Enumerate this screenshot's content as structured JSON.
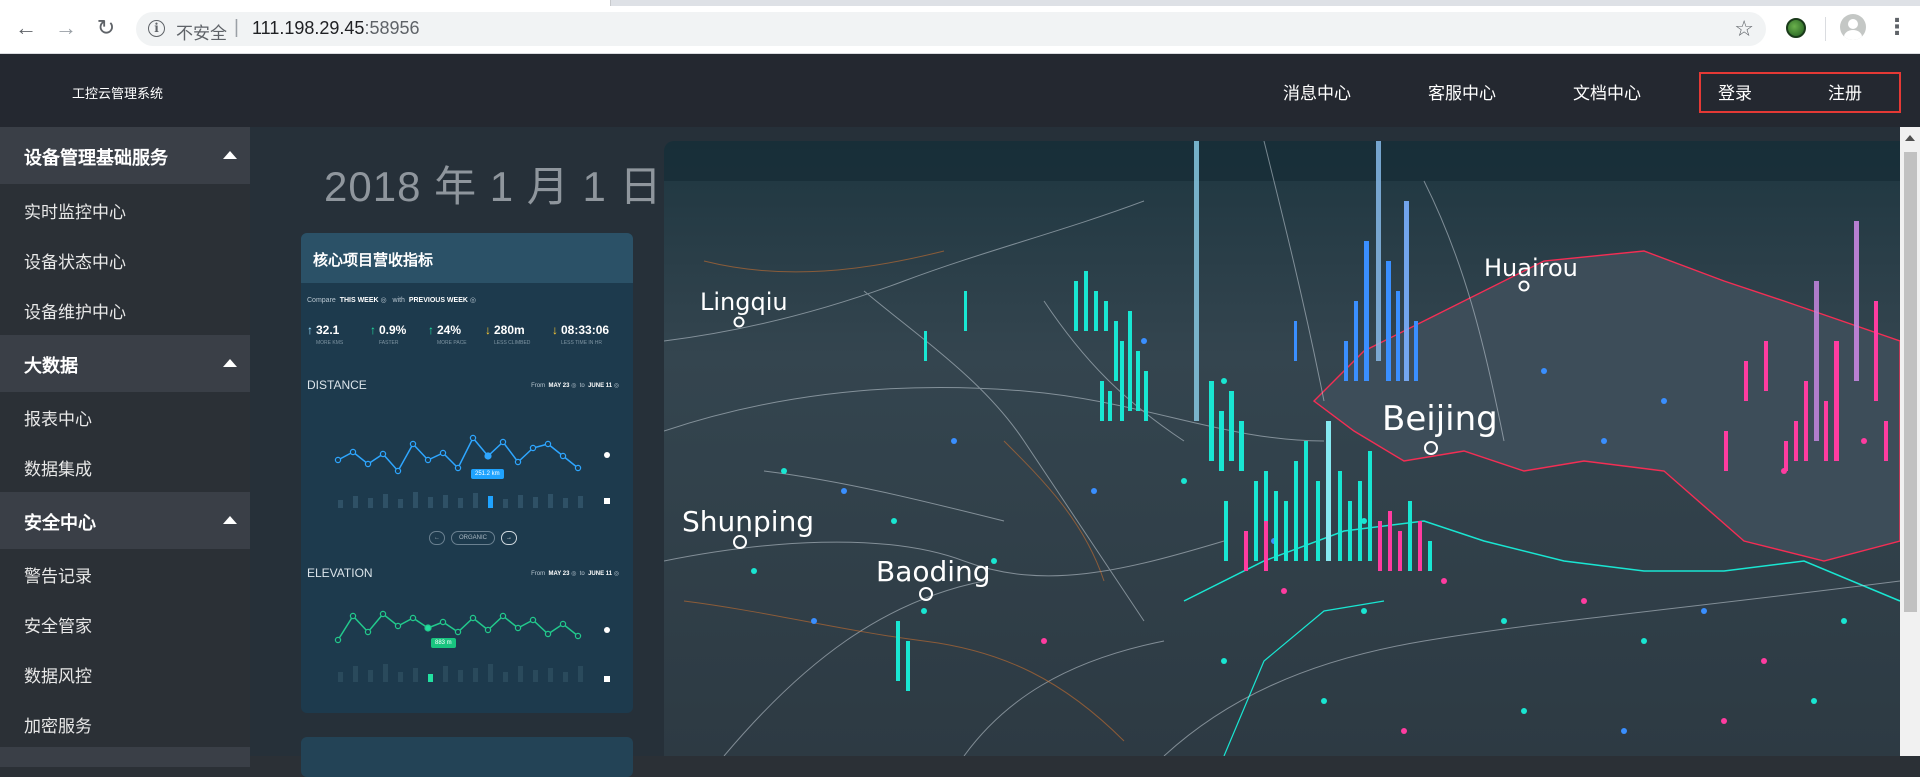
{
  "browser": {
    "insecure_label": "不安全",
    "separator": "|",
    "host": "111.198.29.45",
    "port": ":58956"
  },
  "header": {
    "brand": "工控云管理系统",
    "nav": [
      "消息中心",
      "客服中心",
      "文档中心"
    ],
    "login": "登录",
    "register": "注册"
  },
  "sidebar": {
    "sections": [
      {
        "title": "设备管理基础服务",
        "items": [
          "实时监控中心",
          "设备状态中心",
          "设备维护中心"
        ]
      },
      {
        "title": "大数据",
        "items": [
          "报表中心",
          "数据集成"
        ]
      },
      {
        "title": "安全中心",
        "items": [
          "警告记录",
          "安全管家",
          "数据风控",
          "加密服务"
        ]
      }
    ]
  },
  "main": {
    "date": "2018 年 1 月 1 日",
    "card_title": "核心项目营收指标",
    "compare": {
      "label": "Compare",
      "this_week": "THIS WEEK",
      "with": "with",
      "prev_week": "PREVIOUS WEEK"
    },
    "stats": [
      {
        "value": "32.1",
        "label": "MORE KMS"
      },
      {
        "value": "0.9%",
        "label": "FASTER"
      },
      {
        "value": "24%",
        "label": "MORE PACE"
      },
      {
        "value": "280m",
        "label": "LESS CLIMBED"
      },
      {
        "value": "08:33:06",
        "label": "LESS TIME IN HR"
      }
    ],
    "distance": {
      "label": "DISTANCE",
      "from": "From",
      "from_date": "MAY 23",
      "to": "to",
      "to_date": "JUNE 11",
      "tooltip": "251.2 km"
    },
    "elevation": {
      "label": "ELEVATION",
      "from": "From",
      "from_date": "MAY 23",
      "to": "to",
      "to_date": "JUNE 11",
      "tooltip": "883 m"
    },
    "pager": {
      "prev": "←",
      "mid": "ORGANIC",
      "next": "→"
    },
    "map_cities": [
      "Lingqiu",
      "Huairou",
      "Beijing",
      "Shunping",
      "Baoding"
    ]
  },
  "colors": {
    "header_bg": "#242830",
    "sidebar_bg": "#2b3036",
    "section_bg": "#3a3f47",
    "main_bg": "#263039",
    "card_bg": "#1d3a4d",
    "highlight_border": "#e53935",
    "cyan": "#19e6d2",
    "magenta": "#ff3ca0",
    "blue": "#3a8fff"
  },
  "icons": [
    "back-arrow-icon",
    "forward-arrow-icon",
    "reload-icon",
    "info-icon",
    "star-icon",
    "extension-icon",
    "profile-avatar-icon",
    "menu-kebab-icon",
    "caret-up-icon"
  ]
}
